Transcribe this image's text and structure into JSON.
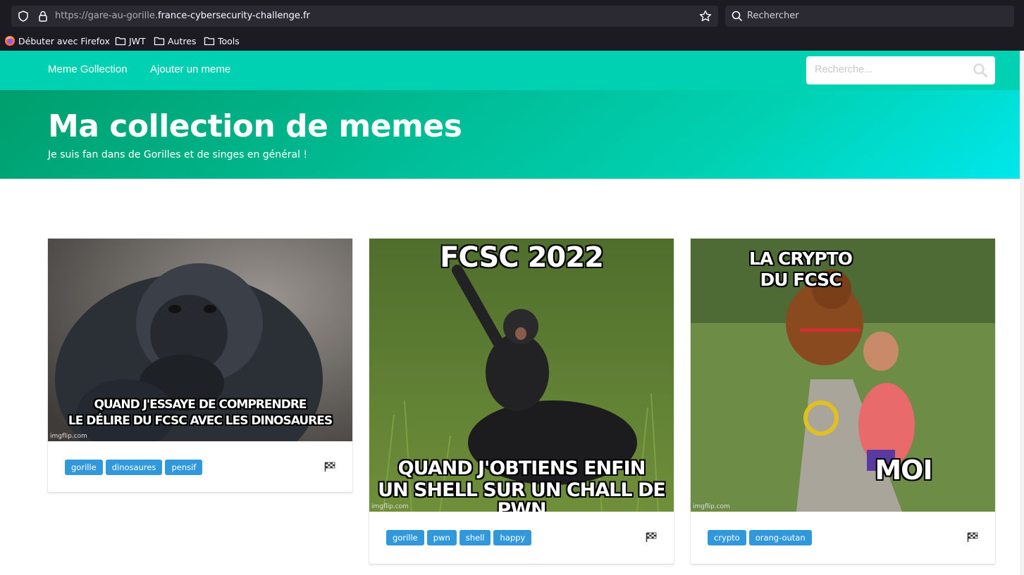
{
  "browser": {
    "url_prefix": "https://gare-au-gorille.",
    "url_domain": "france-cybersecurity-challenge.fr",
    "search_placeholder": "Rechercher",
    "bookmarks": [
      {
        "label": "Débuter avec Firefox",
        "icon": "firefox-icon"
      },
      {
        "label": "JWT",
        "icon": "folder-icon"
      },
      {
        "label": "Autres",
        "icon": "folder-icon"
      },
      {
        "label": "Tools",
        "icon": "folder-icon"
      }
    ]
  },
  "navbar": {
    "brand": "Meme Gollection",
    "add_link": "Ajouter un meme",
    "search_placeholder": "Recherche..."
  },
  "hero": {
    "title": "Ma collection de memes",
    "subtitle": "Je suis fan dans de Gorilles et de singes en général !"
  },
  "cards": [
    {
      "top_text": "",
      "bottom_text_1": "QUAND J'ESSAYE DE COMPRENDRE",
      "bottom_text_2": "LE DÉLIRE DU FCSC AVEC LES DINOSAURES",
      "watermark": "imgflip.com",
      "tags": [
        "gorille",
        "dinosaures",
        "pensif"
      ]
    },
    {
      "top_text": "FCSC 2022",
      "bottom_text_1": "QUAND J'OBTIENS ENFIN",
      "bottom_text_2": "UN SHELL SUR UN CHALL DE PWN",
      "watermark": "imgflip.com",
      "tags": [
        "gorille",
        "pwn",
        "shell",
        "happy"
      ]
    },
    {
      "top_text_1": "LA CRYPTO",
      "top_text_2": "DU FCSC",
      "side_text": "MOI",
      "watermark": "imgflip.com",
      "tags": [
        "crypto",
        "orang-outan"
      ]
    }
  ],
  "colors": {
    "primary": "#00d1b2",
    "tag": "#3298dc",
    "chrome": "#1c1b22"
  }
}
